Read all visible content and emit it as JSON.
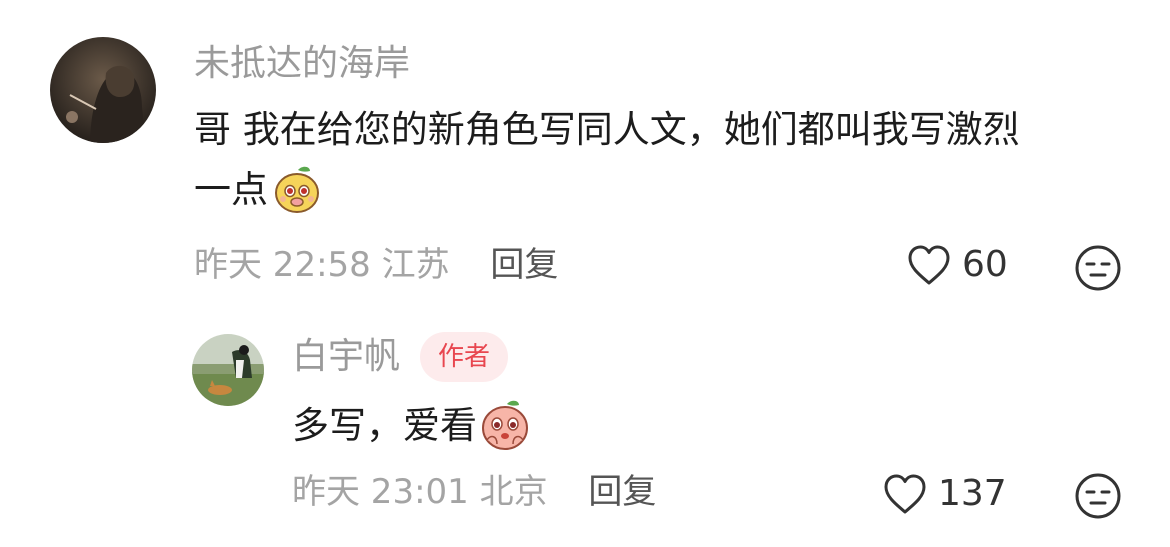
{
  "comments": [
    {
      "username": "未抵达的海岸",
      "content": "哥 我在给您的新角色写同人文，她们都叫我写激烈一点",
      "content_line1": "哥 我在给您的新角色写同人文，她们都叫我写激烈",
      "content_line2": "一点",
      "emoji": "smiling-face-emoji",
      "time": "昨天 22:58",
      "location": "江苏",
      "reply_label": "回复",
      "likes": "60"
    },
    {
      "username": "白宇帆",
      "badge": "作者",
      "content": "多写，爱看",
      "emoji": "pleading-face-emoji",
      "time": "昨天 23:01",
      "location": "北京",
      "reply_label": "回复",
      "likes": "137"
    }
  ],
  "icons": {
    "like": "heart-outline-icon",
    "dislike": "meh-face-icon"
  },
  "colors": {
    "badge_bg": "#fdebec",
    "badge_text": "#e8464f",
    "username": "#9a9a9a",
    "meta": "#a4a4a4"
  }
}
